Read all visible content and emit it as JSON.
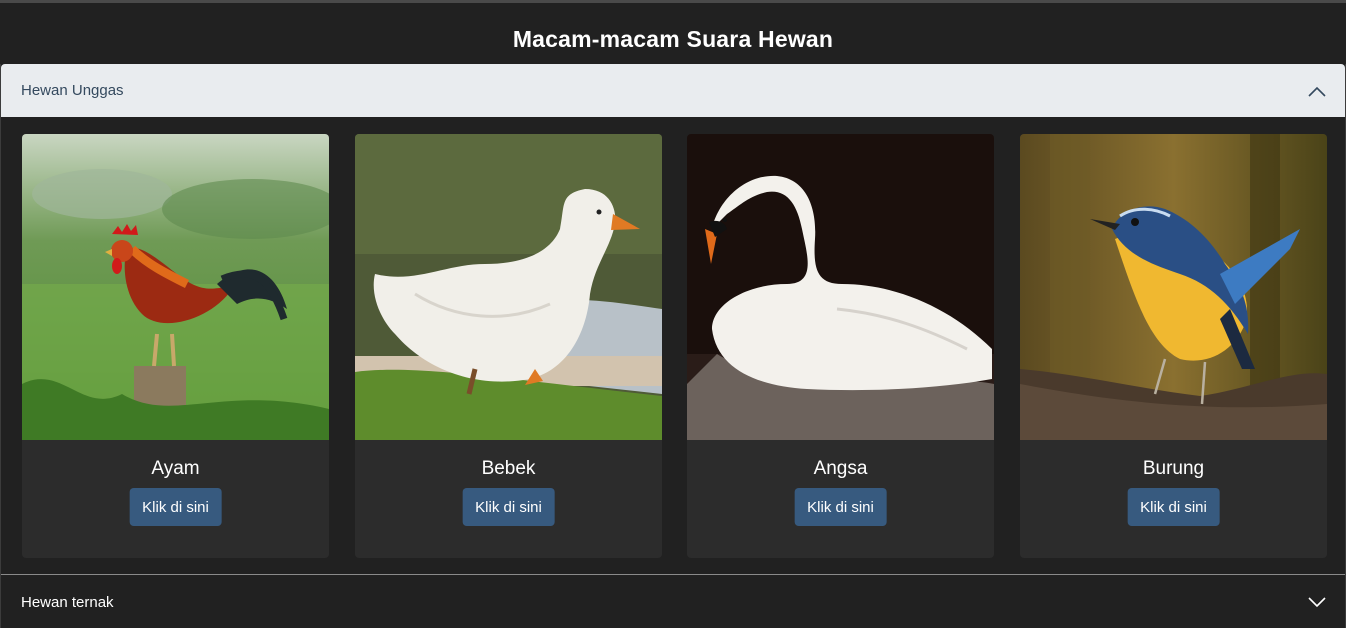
{
  "page": {
    "title": "Macam-macam Suara Hewan"
  },
  "accordion": {
    "sections": [
      {
        "label": "Hewan Unggas",
        "expanded": true
      },
      {
        "label": "Hewan ternak",
        "expanded": false
      }
    ]
  },
  "cards": [
    {
      "name": "Ayam",
      "button_label": "Klik di sini",
      "image": "rooster-photo"
    },
    {
      "name": "Bebek",
      "button_label": "Klik di sini",
      "image": "duck-photo"
    },
    {
      "name": "Angsa",
      "button_label": "Klik di sini",
      "image": "swan-photo"
    },
    {
      "name": "Burung",
      "button_label": "Klik di sini",
      "image": "bluebird-photo"
    }
  ],
  "colors": {
    "background": "#212121",
    "card": "#2c2c2c",
    "button": "#375a7f",
    "accordion_active": "#e9ecef",
    "accordion_active_text": "#34495e"
  },
  "icons": {
    "expanded": "chevron-up-icon",
    "collapsed": "chevron-down-icon"
  }
}
